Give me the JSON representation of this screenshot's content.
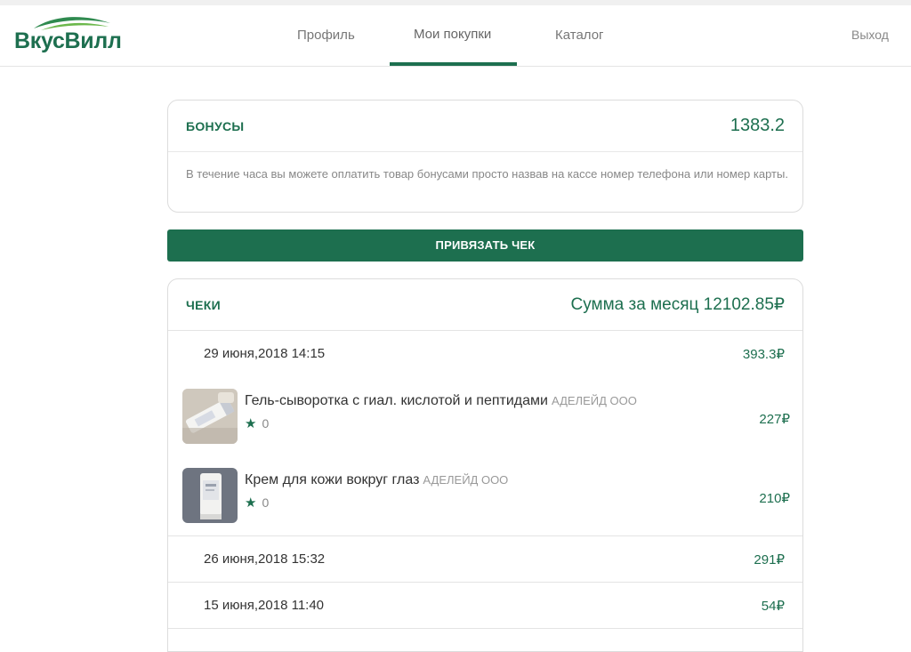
{
  "header": {
    "logo_text": "ВкусВилл",
    "nav": [
      {
        "label": "Профиль"
      },
      {
        "label": "Мои покупки",
        "active": true
      },
      {
        "label": "Каталог"
      }
    ],
    "logout_label": "Выход"
  },
  "bonus": {
    "title": "БОНУСЫ",
    "value": "1383.2",
    "note": "В течение часа вы можете оплатить товар бонусами просто назвав на кассе номер телефона или номер карты."
  },
  "attach_button_label": "ПРИВЯЗАТЬ ЧЕК",
  "checks": {
    "title": "ЧЕКИ",
    "month_sum": "Сумма за месяц 12102.85₽",
    "receipts": [
      {
        "date": "29 июня,2018 14:15",
        "total": "393.3₽",
        "items": [
          {
            "name": "Гель-сыворотка с гиал. кислотой и пептидами",
            "vendor": "АДЕЛЕЙД ООО",
            "rating": "0",
            "price": "227₽"
          },
          {
            "name": "Крем для кожи вокруг глаз",
            "vendor": "АДЕЛЕЙД ООО",
            "rating": "0",
            "price": "210₽"
          }
        ]
      },
      {
        "date": "26 июня,2018 15:32",
        "total": "291₽"
      },
      {
        "date": "15 июня,2018 11:40",
        "total": "54₽"
      }
    ]
  },
  "colors": {
    "brand": "#1d6f4f"
  },
  "icons": {
    "rating": "star-icon"
  }
}
